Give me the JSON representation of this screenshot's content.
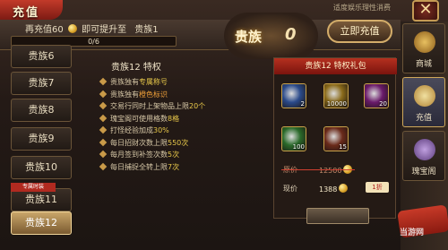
{
  "window": {
    "title": "充值",
    "note": "适度娱乐理性消费",
    "close_symbol": "✕"
  },
  "recharge": {
    "prefix": "再充值60",
    "suffix": "即可提升至",
    "target": "贵族1",
    "progress_text": "0/6",
    "progress_fraction": 0.0
  },
  "vip": {
    "label": "贵族",
    "level": "0"
  },
  "buttons": {
    "recharge": "立即充值"
  },
  "sidebar": {
    "items": [
      "贵族6",
      "贵族7",
      "贵族8",
      "贵族9",
      "贵族10",
      "贵族11",
      "贵族12"
    ],
    "tag": "专属时装",
    "active_index": 6
  },
  "privileges": {
    "title": "贵族12 特权",
    "items": [
      {
        "pre": "贵族独有",
        "hl": "专属称号",
        "post": ""
      },
      {
        "pre": "贵族独有",
        "hl": "橙色标识",
        "post": ""
      },
      {
        "pre": "交易行同时上架物品上限",
        "hl": "20个",
        "post": ""
      },
      {
        "pre": "瑰宝阁可使用格数",
        "hl": "8格",
        "post": ""
      },
      {
        "pre": "打怪经验加成",
        "hl": "30%",
        "post": ""
      },
      {
        "pre": "每日招财次数上限",
        "hl": "550次",
        "post": ""
      },
      {
        "pre": "每月签到补签次数",
        "hl": "5次",
        "post": ""
      },
      {
        "pre": "每日捕捉全转上限",
        "hl": "7次",
        "post": ""
      }
    ]
  },
  "gift": {
    "title": "贵族12 特权礼包",
    "slots": [
      {
        "icon": "ring-icon",
        "count": "2",
        "color": "#2a4a8a"
      },
      {
        "icon": "gold-ingot-icon",
        "count": "10000",
        "color": "#8a6a1a"
      },
      {
        "icon": "wings-icon",
        "count": "20",
        "color": "#6a1a6a"
      },
      {
        "icon": "fire-orb-icon",
        "count": "100",
        "color": "#2a6a2a"
      },
      {
        "icon": "red-orb-icon",
        "count": "15",
        "color": "#6a2a1a"
      }
    ],
    "original_label": "原价",
    "original_price": "12500",
    "current_label": "现价",
    "current_price": "1388",
    "discount": "1折"
  },
  "right_tabs": [
    {
      "label": "商城",
      "icon": "mall-icon"
    },
    {
      "label": "充值",
      "icon": "recharge-icon"
    },
    {
      "label": "瑰宝阁",
      "icon": "treasure-icon"
    }
  ],
  "watermark": "当游网"
}
